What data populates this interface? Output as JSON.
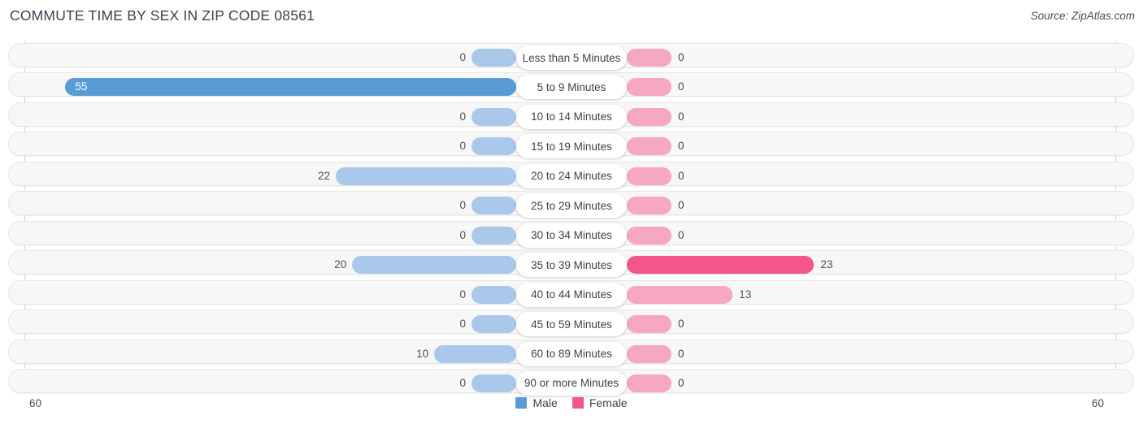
{
  "header": {
    "title": "COMMUTE TIME BY SEX IN ZIP CODE 08561",
    "source": "Source: ZipAtlas.com"
  },
  "axis": {
    "left_end_label": "60",
    "right_end_label": "60"
  },
  "legend": {
    "items": [
      {
        "label": "Male",
        "color": "#5b9bd5"
      },
      {
        "label": "Female",
        "color": "#f2568c"
      }
    ]
  },
  "colors": {
    "male_light": "#a9c8ea",
    "male_strong": "#5b9bd5",
    "female_light": "#f6a7c1",
    "female_strong": "#f2568c",
    "row_track": "#f7f7f7",
    "row_border": "#e6e6e6",
    "text": "#3c4250"
  },
  "chart_data": {
    "type": "bar",
    "title": "COMMUTE TIME BY SEX IN ZIP CODE 08561",
    "subtitle": "",
    "orientation": "horizontal-diverging",
    "xlabel": "",
    "ylabel": "",
    "xlim": [
      60,
      60
    ],
    "grid": false,
    "legend_position": "bottom-center",
    "categories": [
      "Less than 5 Minutes",
      "5 to 9 Minutes",
      "10 to 14 Minutes",
      "15 to 19 Minutes",
      "20 to 24 Minutes",
      "25 to 29 Minutes",
      "30 to 34 Minutes",
      "35 to 39 Minutes",
      "40 to 44 Minutes",
      "45 to 59 Minutes",
      "60 to 89 Minutes",
      "90 or more Minutes"
    ],
    "series": [
      {
        "name": "Male",
        "values": [
          0,
          55,
          0,
          0,
          22,
          0,
          0,
          20,
          0,
          0,
          10,
          0
        ]
      },
      {
        "name": "Female",
        "values": [
          0,
          0,
          0,
          0,
          0,
          0,
          0,
          23,
          13,
          0,
          0,
          0
        ]
      }
    ],
    "rows": [
      {
        "category": "Less than 5 Minutes",
        "male": 0,
        "female": 0,
        "male_label": "0",
        "female_label": "0"
      },
      {
        "category": "5 to 9 Minutes",
        "male": 55,
        "female": 0,
        "male_label": "55",
        "female_label": "0"
      },
      {
        "category": "10 to 14 Minutes",
        "male": 0,
        "female": 0,
        "male_label": "0",
        "female_label": "0"
      },
      {
        "category": "15 to 19 Minutes",
        "male": 0,
        "female": 0,
        "male_label": "0",
        "female_label": "0"
      },
      {
        "category": "20 to 24 Minutes",
        "male": 22,
        "female": 0,
        "male_label": "22",
        "female_label": "0"
      },
      {
        "category": "25 to 29 Minutes",
        "male": 0,
        "female": 0,
        "male_label": "0",
        "female_label": "0"
      },
      {
        "category": "30 to 34 Minutes",
        "male": 0,
        "female": 0,
        "male_label": "0",
        "female_label": "0"
      },
      {
        "category": "35 to 39 Minutes",
        "male": 20,
        "female": 23,
        "male_label": "20",
        "female_label": "23"
      },
      {
        "category": "40 to 44 Minutes",
        "male": 0,
        "female": 13,
        "male_label": "0",
        "female_label": "13"
      },
      {
        "category": "45 to 59 Minutes",
        "male": 0,
        "female": 0,
        "male_label": "0",
        "female_label": "0"
      },
      {
        "category": "60 to 89 Minutes",
        "male": 10,
        "female": 0,
        "male_label": "10",
        "female_label": "0"
      },
      {
        "category": "90 or more Minutes",
        "male": 0,
        "female": 0,
        "male_label": "0",
        "female_label": "0"
      }
    ]
  }
}
